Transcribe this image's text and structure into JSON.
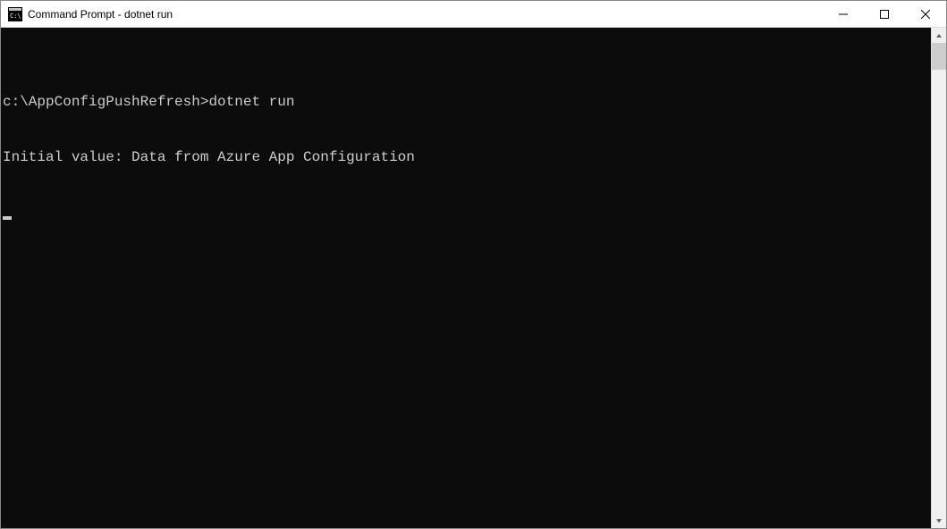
{
  "window": {
    "title": "Command Prompt - dotnet  run"
  },
  "terminal": {
    "prompt_path": "c:\\AppConfigPushRefresh>",
    "command": "dotnet run",
    "output_line1": "Initial value: Data from Azure App Configuration"
  }
}
